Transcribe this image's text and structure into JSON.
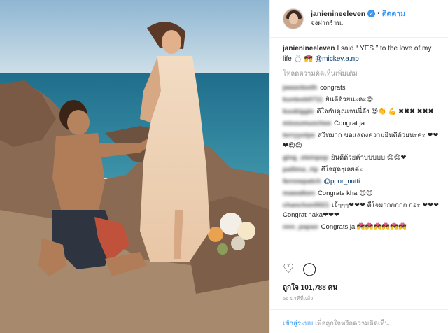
{
  "post": {
    "username": "janienineeleven",
    "follow_label": "ติดตาม",
    "dot": "•",
    "location": "จงฝากร้าน.",
    "verified_icon": "check-icon"
  },
  "caption": {
    "username": "janienineeleven",
    "text": "I said “ YES ” to the love of my life 💍 💏 ",
    "mention": "@mickey.a.np"
  },
  "load_more": "โหลดความคิดเห็นเพิ่มเติม",
  "comments": [
    {
      "user": "jawanteeth",
      "text": "congrats"
    },
    {
      "user": "kunteeb0711",
      "text": "ยินดีด้วยนะคะ😊"
    },
    {
      "user": "kuukiggie",
      "text": "ดีใจกับคุณเจนนี่จัง 😍👏 💪 ✖✖✖ ✖✖✖"
    },
    {
      "user": "missumuochee",
      "text": "Congrat ja"
    },
    {
      "user": "terryyolpe",
      "text": "สวีทมาก ขอแสดงความยินดีด้วยนะคะ ❤❤❤😍😊"
    },
    {
      "user": "ging_steinpop",
      "text": "ยินดีด้วยค้าบบบบบ 😊😊❤"
    },
    {
      "user": "pallima_rtp",
      "text": "ดีใจสุดๆเลยค่ะ"
    },
    {
      "user": "fernnepatch",
      "text": "@ppor_nutti"
    },
    {
      "user": "mawalben",
      "text": "Congrats kha 😍😍"
    },
    {
      "user": "chanchon0021",
      "text": "เย้ๆๆๆ❤❤❤ ดีใจมากกกกก กอ่ะ ❤❤❤Congrat naka❤❤❤"
    },
    {
      "user": "nnn_papao",
      "text": "Congrats ja 💏💏💏💏💏💏"
    }
  ],
  "likes": "ถูกใจ 101,788 คน",
  "time": "56 นาทีที่แล้ว",
  "login": {
    "link": "เข้าสู่ระบบ",
    "rest": "เพื่อถูกใจหรือความคิดเห็น"
  },
  "icons": {
    "like": "heart-icon",
    "comment": "comment-icon"
  }
}
